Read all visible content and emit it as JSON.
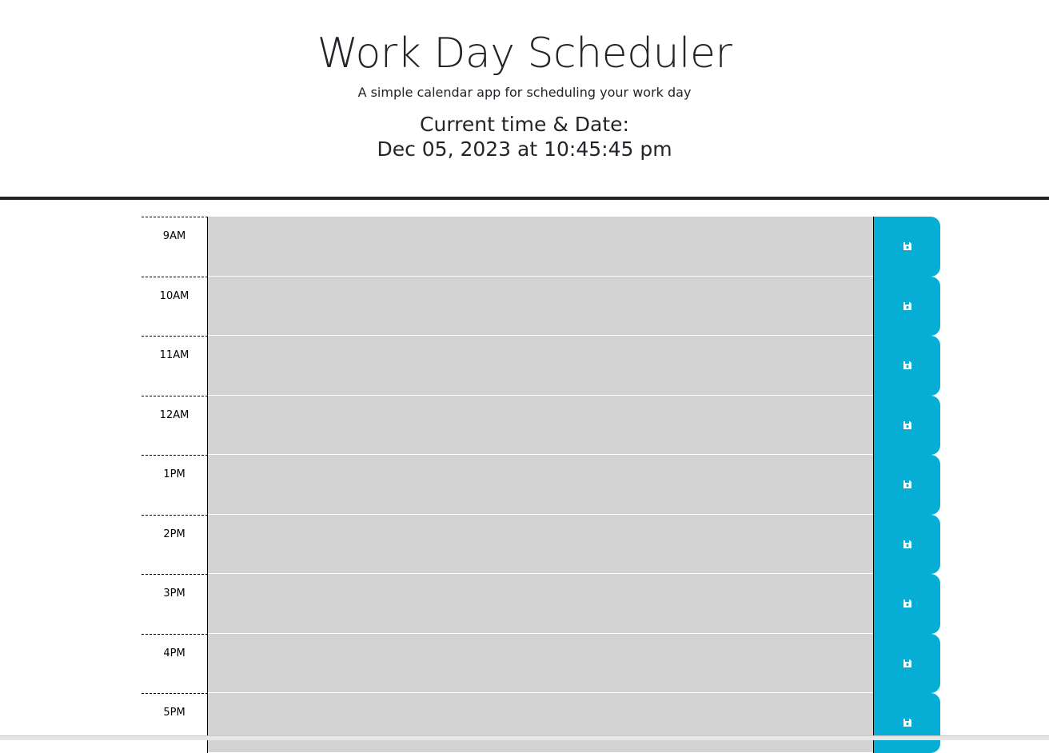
{
  "header": {
    "title": "Work Day Scheduler",
    "subtitle": "A simple calendar app for scheduling your work day",
    "datetime_label": "Current time & Date:",
    "datetime_value": "Dec 05, 2023 at 10:45:45 pm"
  },
  "colors": {
    "save_button": "#06aed5",
    "textarea_past": "#d3d3d3",
    "text": "#212529"
  },
  "rows": [
    {
      "hour": "9AM",
      "description": "",
      "save_icon": "save-icon"
    },
    {
      "hour": "10AM",
      "description": "",
      "save_icon": "save-icon"
    },
    {
      "hour": "11AM",
      "description": "",
      "save_icon": "save-icon"
    },
    {
      "hour": "12AM",
      "description": "",
      "save_icon": "save-icon"
    },
    {
      "hour": "1PM",
      "description": "",
      "save_icon": "save-icon"
    },
    {
      "hour": "2PM",
      "description": "",
      "save_icon": "save-icon"
    },
    {
      "hour": "3PM",
      "description": "",
      "save_icon": "save-icon"
    },
    {
      "hour": "4PM",
      "description": "",
      "save_icon": "save-icon"
    },
    {
      "hour": "5PM",
      "description": "",
      "save_icon": "save-icon"
    }
  ]
}
